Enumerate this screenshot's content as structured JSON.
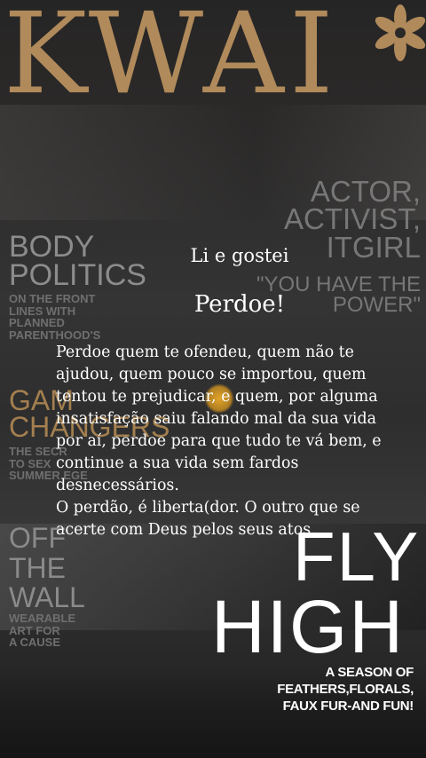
{
  "logo": {
    "text": "KWAI",
    "color": "#b08a5b"
  },
  "background_text": {
    "actor_block": [
      "ACTOR,",
      "ACTIVIST,",
      "ITGIRL"
    ],
    "quote_block": [
      "\"YOU HAVE THE",
      "POWER\""
    ],
    "body_politics": [
      "BODY",
      "POLITICS"
    ],
    "body_politics_sub": [
      "ON THE FRONT",
      "LINES WITH",
      "PLANNED",
      "PARENTHOOD'S"
    ],
    "game_changers": [
      "GAM",
      "CHANGERS"
    ],
    "game_changers_sub": [
      "THE SECR",
      "TO SEX",
      "SUMMER EGE"
    ],
    "off_the_wall": [
      "OFF",
      "THE",
      "WALL"
    ],
    "off_the_wall_sub": [
      "WEARABLE",
      "ART FOR",
      "A CAUSE"
    ],
    "fly_high": [
      "FLY",
      "HIGH"
    ],
    "fly_high_sub": [
      "A SEASON OF",
      "FEATHERS,FLORALS,",
      "FAUX FUR-AND FUN!"
    ]
  },
  "post": {
    "kicker": "Li e gostei",
    "title": "Perdoe!",
    "paragraph1": "Perdoe quem te ofendeu, quem não te ajudou, quem pouco se importou, quem tentou te prejudicar, e quem, por alguma insatisfação saiu falando mal da sua vida por aí, perdoe para que tudo te vá bem, e continue a sua vida sem fardos desnecessários.",
    "paragraph2": "O perdão, é liberta(dor. O outro que se acerte com Deus pelos seus atos."
  }
}
